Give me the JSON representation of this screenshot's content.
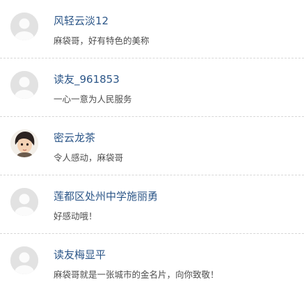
{
  "comments": [
    {
      "username": "风轻云淡12",
      "text": "麻袋哥，好有特色的美称",
      "avatar": "default-avatar-icon"
    },
    {
      "username": "读友_961853",
      "text": "一心一意为人民服务",
      "avatar": "default-avatar-icon"
    },
    {
      "username": "密云龙茶",
      "text": "令人感动，麻袋哥",
      "avatar": "cartoon-person-avatar"
    },
    {
      "username": "莲都区处州中学施丽勇",
      "text": "好感动哦！",
      "avatar": "default-avatar-icon"
    },
    {
      "username": "读友梅显平",
      "text": "麻袋哥就是一张城市的金名片，向你致敬！",
      "avatar": "default-avatar-icon"
    }
  ],
  "colors": {
    "username": "#2c5688",
    "comment_text": "#4d4d4d",
    "divider": "#d7d7d7",
    "avatar_bg": "#e2e2e2"
  }
}
